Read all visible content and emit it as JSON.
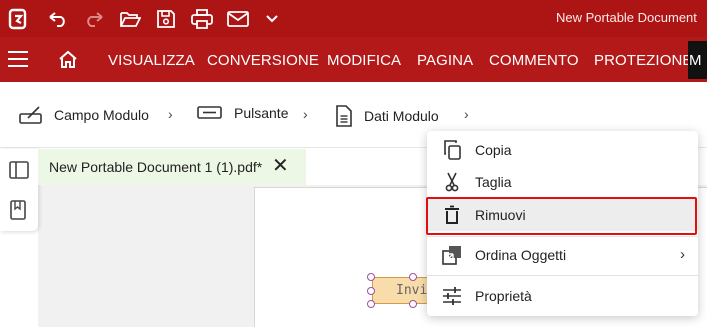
{
  "title_bar": {
    "document_title": "New Portable Document",
    "icons": [
      "app-logo-icon",
      "undo-icon",
      "redo-icon",
      "open-folder-icon",
      "save-icon",
      "print-icon",
      "email-icon",
      "quick-access-dropdown-icon"
    ]
  },
  "ribbon": {
    "tabs": [
      "VISUALIZZA",
      "CONVERSIONE",
      "MODIFICA",
      "PAGINA",
      "COMMENTO",
      "PROTEZIONE",
      "M"
    ]
  },
  "toolbar": {
    "items": [
      "Campo Modulo",
      "Pulsante",
      "Dati Modulo"
    ],
    "separator": "›"
  },
  "document_tab": {
    "label": "New Portable Document 1 (1).pdf*",
    "close": "✕"
  },
  "canvas": {
    "form_button_text": "Invia"
  },
  "context_menu": {
    "items": [
      {
        "label": "Copia",
        "icon": "copy-icon"
      },
      {
        "label": "Taglia",
        "icon": "scissors-icon"
      },
      {
        "label": "Rimuovi",
        "icon": "trash-icon"
      },
      {
        "label": "Ordina Oggetti",
        "icon": "arrange-objects-icon",
        "submenu": "›"
      },
      {
        "label": "Proprietà",
        "icon": "properties-sliders-icon"
      }
    ],
    "highlighted": "Rimuovi"
  },
  "colors": {
    "title_bar": "#ad1515",
    "ribbon": "#b4191a",
    "document_tab": "#ecf7e5",
    "highlight_border": "#e01010",
    "form_button_fill": "#f8dca9"
  }
}
